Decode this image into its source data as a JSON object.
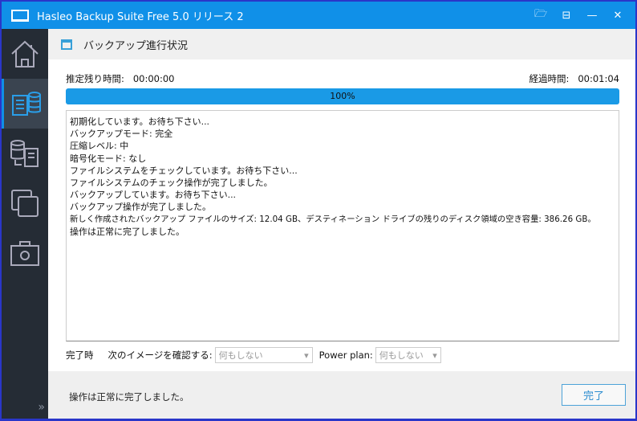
{
  "title": "Hasleo Backup Suite Free 5.0 リリース 2",
  "header": "バックアップ進行状況",
  "remaining_label": "推定残り時間:",
  "remaining_value": "00:00:00",
  "elapsed_label": "経過時間:",
  "elapsed_value": "00:01:04",
  "progress_percent": 100,
  "progress_label": "100%",
  "log": [
    "初期化しています。お待ち下さい...",
    "バックアップモード: 完全",
    "圧縮レベル: 中",
    "暗号化モード: なし",
    "ファイルシステムをチェックしています。お待ち下さい...",
    "ファイルシステムのチェック操作が完了しました。",
    "バックアップしています。お待ち下さい...",
    "バックアップ操作が完了しました。",
    "新しく作成されたバックアップ ファイルのサイズ: 12.04 GB、デスティネーション ドライブの残りのディスク領域の空き容量: 386.26 GB。",
    "操作は正常に完了しました。"
  ],
  "on_complete_label": "完了時",
  "verify_label": "次のイメージを確認する:",
  "verify_value": "何もしない",
  "power_label": "Power plan:",
  "power_value": "何もしない",
  "status": "操作は正常に完了しました。",
  "done_button": "完了"
}
